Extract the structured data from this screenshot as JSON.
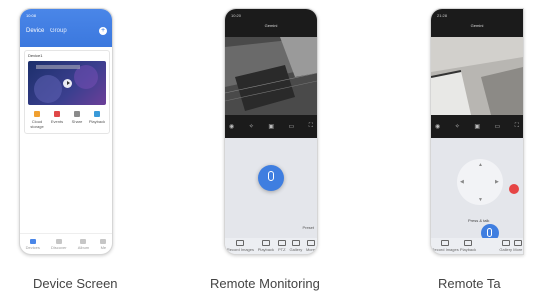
{
  "phone1": {
    "status_time": "10:08",
    "status_icons": "▪ ▪ ▮",
    "tabs": [
      "Device",
      "Group"
    ],
    "add_symbol": "+",
    "device_name": "Device1",
    "actions": [
      {
        "label": "Cloud storage",
        "icon": "cloud-icon",
        "color": "#f0a030"
      },
      {
        "label": "Events",
        "icon": "events-icon",
        "color": "#e04848"
      },
      {
        "label": "Share",
        "icon": "share-icon",
        "color": "#8a8a8a"
      },
      {
        "label": "Playback",
        "icon": "playback-icon",
        "color": "#3a9ad9"
      }
    ],
    "nav": [
      "Devices",
      "Discover",
      "Album",
      "Me"
    ]
  },
  "phone2": {
    "status_time": "10:20",
    "title": "Gemini",
    "controls": [
      "◉",
      "✧",
      "▣",
      "▭",
      "⛶"
    ],
    "preset_label": "Preset",
    "nav": [
      "Record Images",
      "Playback",
      "PTZ",
      "Gallery",
      "More"
    ]
  },
  "phone3": {
    "status_time": "21:28",
    "title": "Gemini",
    "controls": [
      "◉",
      "✧",
      "▣",
      "▭",
      "⛶"
    ],
    "hold_label": "Press & talk",
    "nav": [
      "Record Images",
      "Playback",
      "Gallery",
      "More"
    ]
  },
  "captions": [
    "Device Screen",
    "Remote Monitoring",
    "Remote Ta"
  ],
  "colors": {
    "accent": "#3f7ee0",
    "header_blue": "#4a86e8",
    "hangup_red": "#e64545"
  }
}
